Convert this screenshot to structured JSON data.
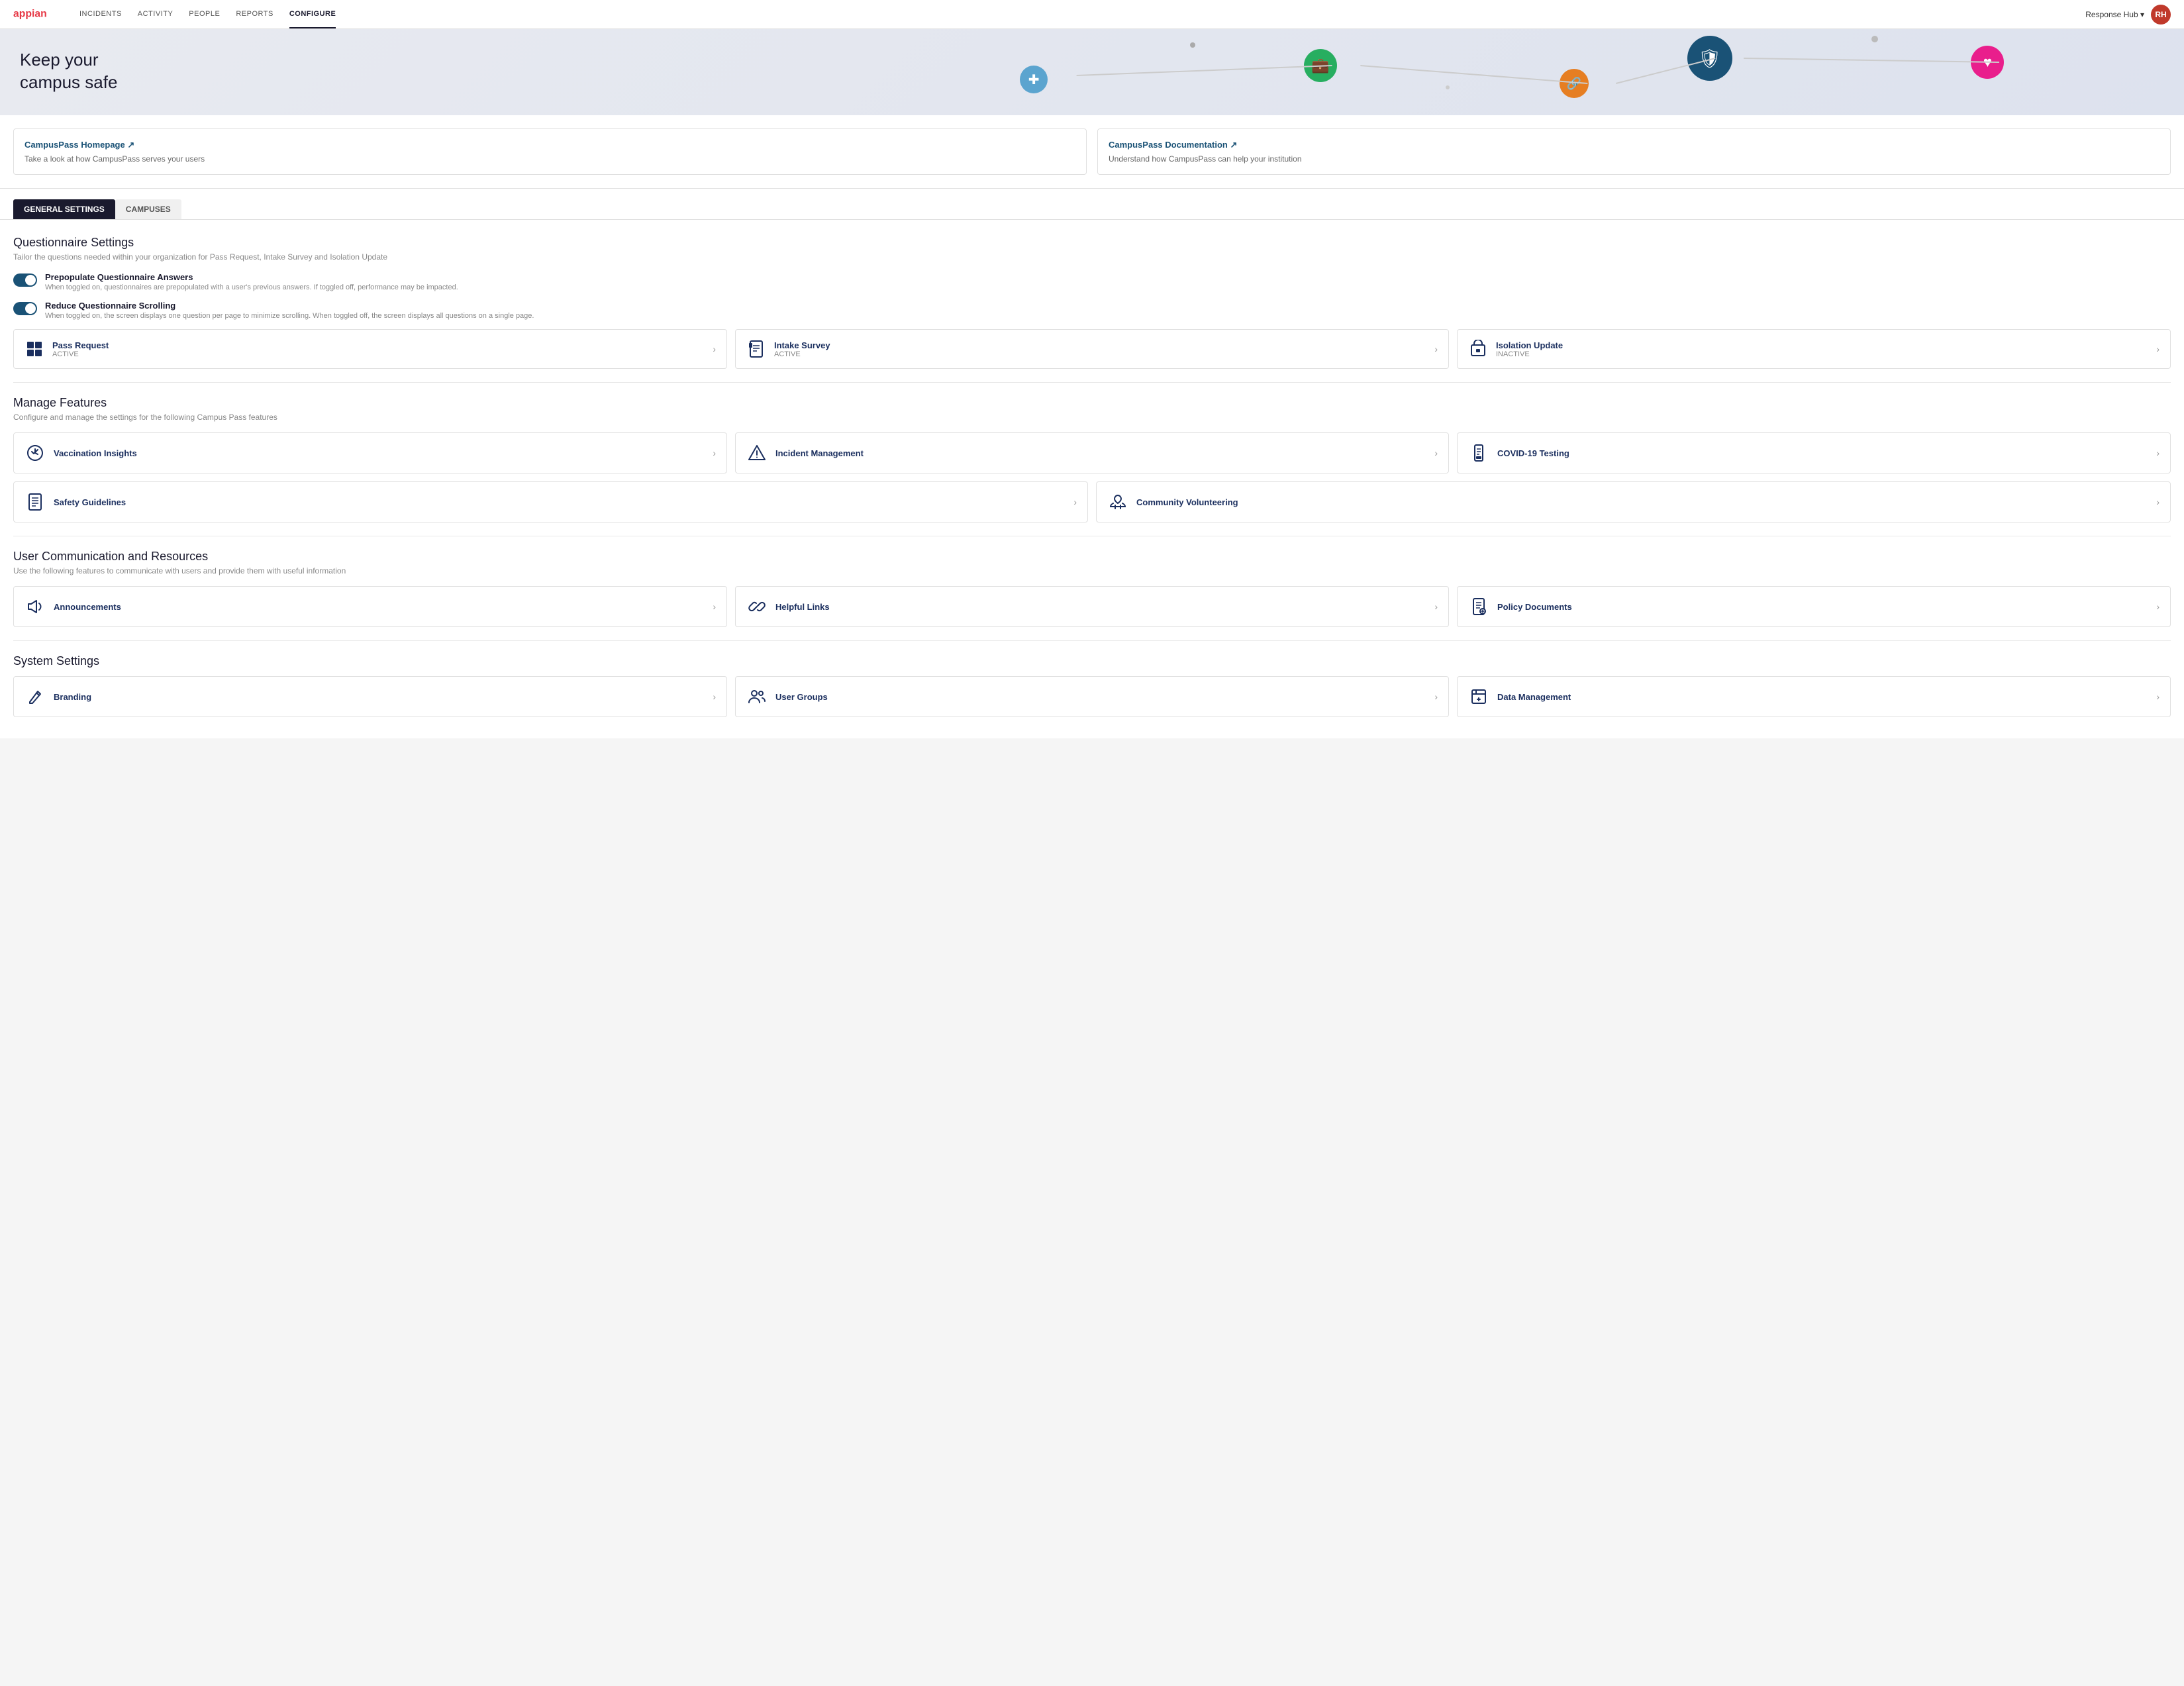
{
  "nav": {
    "logo_text": "appian",
    "links": [
      {
        "label": "INCIDENTS",
        "active": false
      },
      {
        "label": "ACTIVITY",
        "active": false
      },
      {
        "label": "PEOPLE",
        "active": false
      },
      {
        "label": "REPORTS",
        "active": false
      },
      {
        "label": "CONFIGURE",
        "active": true
      }
    ],
    "user_label": "Response Hub ▾",
    "avatar_initials": "RH"
  },
  "hero": {
    "title_line1": "Keep your",
    "title_line2": "campus safe"
  },
  "link_cards": [
    {
      "title": "CampusPass Homepage ↗",
      "description": "Take a look at how CampusPass serves your users"
    },
    {
      "title": "CampusPass Documentation ↗",
      "description": "Understand how CampusPass can help your institution"
    }
  ],
  "tabs": [
    {
      "label": "GENERAL SETTINGS",
      "active": true
    },
    {
      "label": "CAMPUSES",
      "active": false
    }
  ],
  "questionnaire": {
    "title": "Questionnaire Settings",
    "description": "Tailor the questions needed within your organization for Pass Request, Intake Survey and Isolation Update",
    "toggles": [
      {
        "label": "Prepopulate Questionnaire Answers",
        "sublabel": "When toggled on, questionnaires are prepopulated with a user's previous answers. If toggled off, performance may be impacted.",
        "enabled": true
      },
      {
        "label": "Reduce Questionnaire Scrolling",
        "sublabel": "When toggled on, the screen displays one question per page to minimize scrolling. When toggled off, the screen displays all questions on a single page.",
        "enabled": true
      }
    ],
    "cards": [
      {
        "icon": "⊞",
        "name": "Pass Request",
        "status": "ACTIVE"
      },
      {
        "icon": "📋",
        "name": "Intake Survey",
        "status": "ACTIVE"
      },
      {
        "icon": "🛏",
        "name": "Isolation Update",
        "status": "INACTIVE"
      }
    ]
  },
  "manage_features": {
    "title": "Manage Features",
    "description": "Configure and manage the settings for the following Campus Pass features",
    "cards_row1": [
      {
        "icon": "shield",
        "name": "Vaccination Insights"
      },
      {
        "icon": "warning",
        "name": "Incident Management"
      },
      {
        "icon": "briefcase",
        "name": "COVID-19 Testing"
      }
    ],
    "cards_row2": [
      {
        "icon": "document",
        "name": "Safety Guidelines"
      },
      {
        "icon": "hand",
        "name": "Community Volunteering"
      }
    ]
  },
  "user_communication": {
    "title": "User Communication and Resources",
    "description": "Use the following features to communicate with users and provide them with useful information",
    "cards": [
      {
        "icon": "megaphone",
        "name": "Announcements"
      },
      {
        "icon": "link",
        "name": "Helpful Links"
      },
      {
        "icon": "document2",
        "name": "Policy Documents"
      }
    ]
  },
  "system_settings": {
    "title": "System Settings",
    "cards": [
      {
        "icon": "brush",
        "name": "Branding"
      },
      {
        "icon": "users",
        "name": "User Groups"
      },
      {
        "icon": "save",
        "name": "Data Management"
      }
    ]
  }
}
